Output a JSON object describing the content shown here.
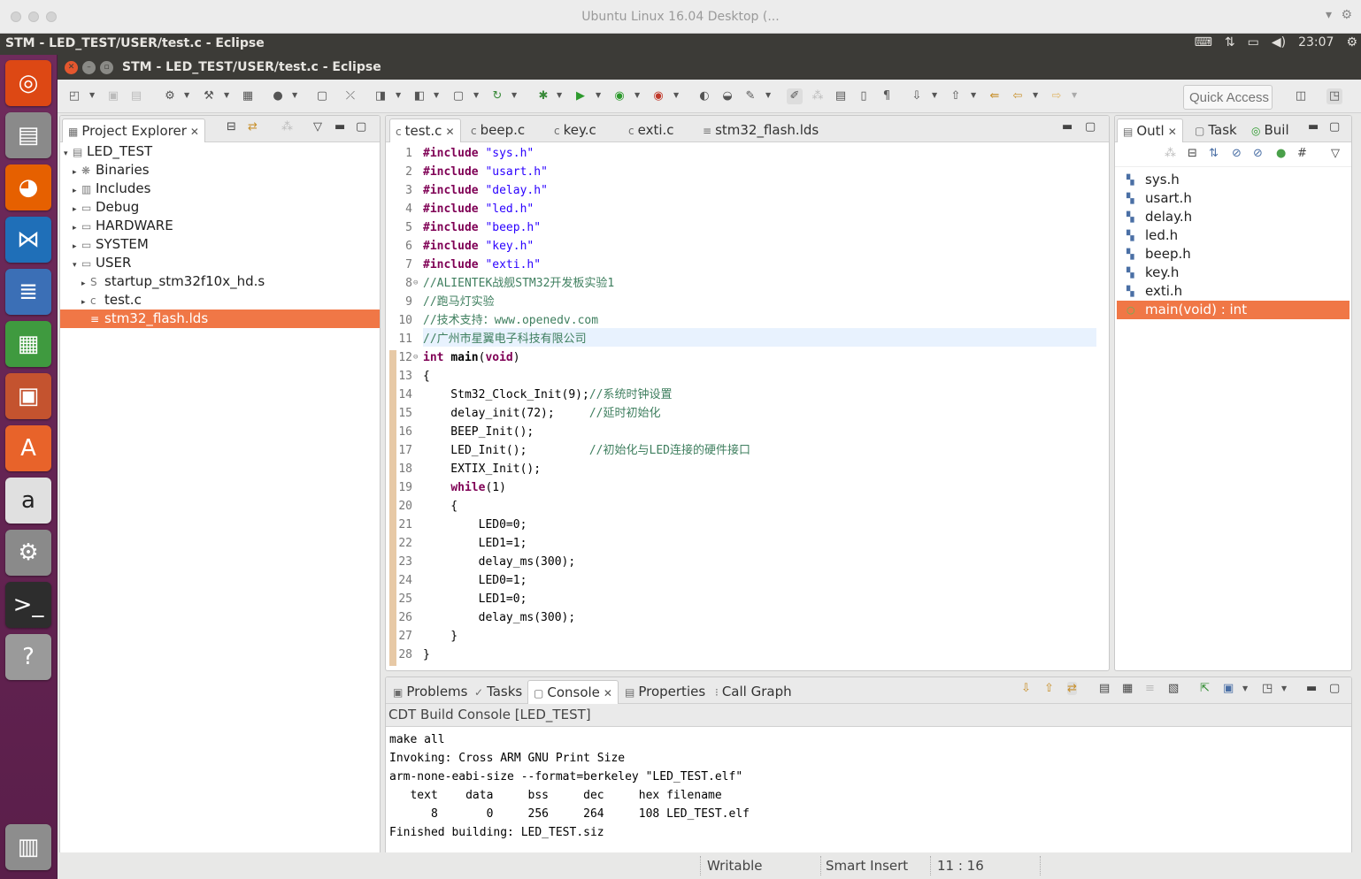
{
  "vm": {
    "title": "Ubuntu Linux 16.04 Desktop (...",
    "right_icons": [
      "chevron-down-icon",
      "gear-icon"
    ]
  },
  "panel": {
    "app_title": "STM - LED_TEST/USER/test.c - Eclipse",
    "time": "23:07"
  },
  "launcher": {
    "items": [
      {
        "name": "ubuntu-dash-icon",
        "color": "#dd4814"
      },
      {
        "name": "files-icon",
        "color": "#8a8a8a"
      },
      {
        "name": "firefox-icon",
        "color": "#e66000"
      },
      {
        "name": "vscode-icon",
        "color": "#1f6fb8"
      },
      {
        "name": "writer-icon",
        "color": "#3b6fb6"
      },
      {
        "name": "calc-icon",
        "color": "#3f9a3f"
      },
      {
        "name": "impress-icon",
        "color": "#c4532f"
      },
      {
        "name": "software-center-icon",
        "color": "#e8632a"
      },
      {
        "name": "amazon-icon",
        "color": "#e0e0e0"
      },
      {
        "name": "system-settings-icon",
        "color": "#8a8a8a"
      },
      {
        "name": "terminal-icon",
        "color": "#2d2d2d"
      },
      {
        "name": "help-icon",
        "color": "#9a9a9a"
      },
      {
        "name": "trash-icon",
        "color": "#8d8d8d"
      }
    ]
  },
  "eclipse": {
    "title": "STM - LED_TEST/USER/test.c - Eclipse",
    "quick_access_placeholder": "Quick Access"
  },
  "project_explorer": {
    "tab_label": "Project Explorer",
    "rows": [
      {
        "label": "LED_TEST",
        "depth": 0,
        "arrow": "▾",
        "icon": "▤"
      },
      {
        "label": "Binaries",
        "depth": 1,
        "arrow": "▸",
        "icon": "❋"
      },
      {
        "label": "Includes",
        "depth": 1,
        "arrow": "▸",
        "icon": "▥"
      },
      {
        "label": "Debug",
        "depth": 1,
        "arrow": "▸",
        "icon": "▭"
      },
      {
        "label": "HARDWARE",
        "depth": 1,
        "arrow": "▸",
        "icon": "▭"
      },
      {
        "label": "SYSTEM",
        "depth": 1,
        "arrow": "▸",
        "icon": "▭"
      },
      {
        "label": "USER",
        "depth": 1,
        "arrow": "▾",
        "icon": "▭"
      },
      {
        "label": "startup_stm32f10x_hd.s",
        "depth": 2,
        "arrow": "▸",
        "icon": "S"
      },
      {
        "label": "test.c",
        "depth": 2,
        "arrow": "▸",
        "icon": "c"
      },
      {
        "label": "stm32_flash.lds",
        "depth": 2,
        "arrow": "",
        "icon": "≡",
        "selected": true
      }
    ]
  },
  "editor": {
    "tabs": [
      "test.c",
      "beep.c",
      "key.c",
      "exti.c",
      "stm32_flash.lds"
    ],
    "active_tab": 0,
    "lines": [
      {
        "n": "1",
        "segs": [
          [
            "kw",
            "#include"
          ],
          [
            "",
            " "
          ],
          [
            "str",
            "\"sys.h\""
          ]
        ]
      },
      {
        "n": "2",
        "segs": [
          [
            "kw",
            "#include"
          ],
          [
            "",
            " "
          ],
          [
            "str",
            "\"usart.h\""
          ]
        ]
      },
      {
        "n": "3",
        "segs": [
          [
            "kw",
            "#include"
          ],
          [
            "",
            " "
          ],
          [
            "str",
            "\"delay.h\""
          ]
        ]
      },
      {
        "n": "4",
        "segs": [
          [
            "kw",
            "#include"
          ],
          [
            "",
            " "
          ],
          [
            "str",
            "\"led.h\""
          ]
        ]
      },
      {
        "n": "5",
        "segs": [
          [
            "kw",
            "#include"
          ],
          [
            "",
            " "
          ],
          [
            "str",
            "\"beep.h\""
          ]
        ]
      },
      {
        "n": "6",
        "segs": [
          [
            "kw",
            "#include"
          ],
          [
            "",
            " "
          ],
          [
            "str",
            "\"key.h\""
          ]
        ]
      },
      {
        "n": "7",
        "segs": [
          [
            "kw",
            "#include"
          ],
          [
            "",
            " "
          ],
          [
            "str",
            "\"exti.h\""
          ]
        ]
      },
      {
        "n": "8",
        "fold": true,
        "segs": [
          [
            "cmt",
            "//ALIENTEK战舰STM32开发板实验1"
          ]
        ]
      },
      {
        "n": "9",
        "segs": [
          [
            "cmt",
            "//跑马灯实验"
          ]
        ]
      },
      {
        "n": "10",
        "segs": [
          [
            "cmt",
            "//技术支持：www.openedv.com"
          ]
        ]
      },
      {
        "n": "11",
        "current": true,
        "segs": [
          [
            "cmt",
            "//广州市星翼电子科技有限公司"
          ]
        ]
      },
      {
        "n": "12",
        "fold": true,
        "segs": [
          [
            "kw",
            "int"
          ],
          [
            "",
            " "
          ],
          [
            "bold",
            "main"
          ],
          [
            "",
            "("
          ],
          [
            "kw",
            "void"
          ],
          [
            "",
            ")"
          ]
        ]
      },
      {
        "n": "13",
        "segs": [
          [
            "",
            "{"
          ]
        ]
      },
      {
        "n": "14",
        "segs": [
          [
            "",
            "    Stm32_Clock_Init(9);"
          ],
          [
            "cmt",
            "//系统时钟设置"
          ]
        ]
      },
      {
        "n": "15",
        "segs": [
          [
            "",
            "    delay_init(72);     "
          ],
          [
            "cmt",
            "//延时初始化"
          ]
        ]
      },
      {
        "n": "16",
        "segs": [
          [
            "",
            "    BEEP_Init();"
          ]
        ]
      },
      {
        "n": "17",
        "segs": [
          [
            "",
            "    LED_Init();         "
          ],
          [
            "cmt",
            "//初始化与LED连接的硬件接口"
          ]
        ]
      },
      {
        "n": "18",
        "segs": [
          [
            "",
            "    EXTIX_Init();"
          ]
        ]
      },
      {
        "n": "19",
        "segs": [
          [
            "",
            "    "
          ],
          [
            "kw",
            "while"
          ],
          [
            "",
            "(1)"
          ]
        ]
      },
      {
        "n": "20",
        "segs": [
          [
            "",
            "    {"
          ]
        ]
      },
      {
        "n": "21",
        "segs": [
          [
            "",
            "        LED0=0;"
          ]
        ]
      },
      {
        "n": "22",
        "segs": [
          [
            "",
            "        LED1=1;"
          ]
        ]
      },
      {
        "n": "23",
        "segs": [
          [
            "",
            "        delay_ms(300);"
          ]
        ]
      },
      {
        "n": "24",
        "segs": [
          [
            "",
            "        LED0=1;"
          ]
        ]
      },
      {
        "n": "25",
        "segs": [
          [
            "",
            "        LED1=0;"
          ]
        ]
      },
      {
        "n": "26",
        "segs": [
          [
            "",
            "        delay_ms(300);"
          ]
        ]
      },
      {
        "n": "27",
        "segs": [
          [
            "",
            "    }"
          ]
        ]
      },
      {
        "n": "28",
        "segs": [
          [
            "",
            "}"
          ]
        ]
      }
    ]
  },
  "outline": {
    "tabs": [
      "Outl",
      "Task",
      "Buil"
    ],
    "items": [
      {
        "label": "sys.h"
      },
      {
        "label": "usart.h"
      },
      {
        "label": "delay.h"
      },
      {
        "label": "led.h"
      },
      {
        "label": "beep.h"
      },
      {
        "label": "key.h"
      },
      {
        "label": "exti.h"
      },
      {
        "label": "main(void) : int",
        "selected": true
      }
    ]
  },
  "bottom": {
    "tabs": [
      "Problems",
      "Tasks",
      "Console",
      "Properties",
      "Call Graph"
    ],
    "active_tab": 2,
    "console_title": "CDT Build Console [LED_TEST]",
    "console_lines": [
      "make all",
      "Invoking: Cross ARM GNU Print Size",
      "arm-none-eabi-size --format=berkeley \"LED_TEST.elf\"",
      "   text    data     bss     dec     hex filename",
      "      8       0     256     264     108 LED_TEST.elf",
      "Finished building: LED_TEST.siz"
    ]
  },
  "status": {
    "writable": "Writable",
    "insert_mode": "Smart Insert",
    "position": "11 : 16"
  }
}
